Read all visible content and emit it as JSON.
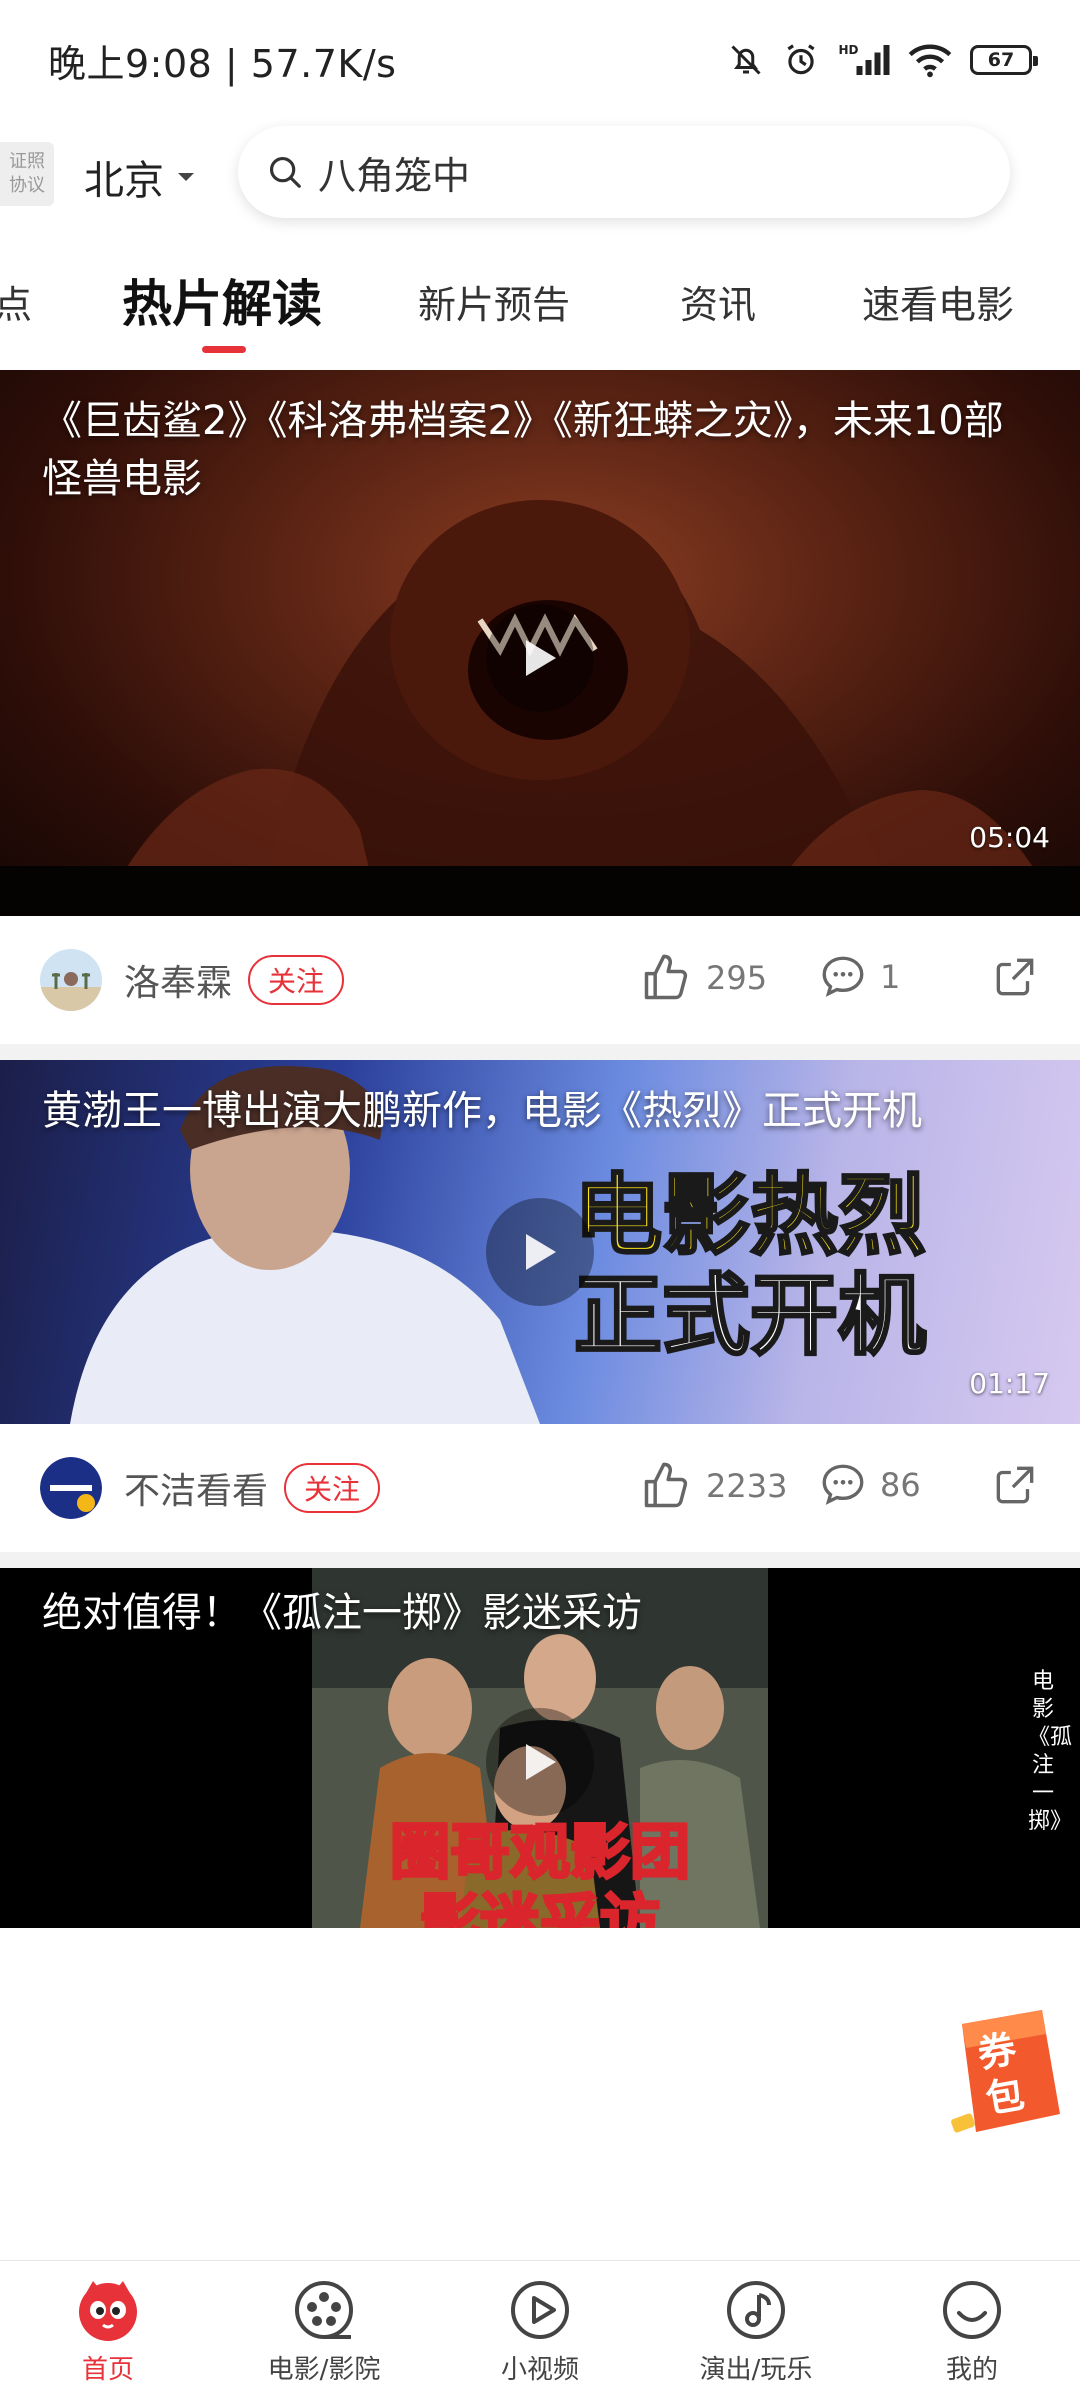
{
  "status": {
    "time": "晚上9:08 | 57.7K/s",
    "battery": "67",
    "icons": [
      "bell-off-icon",
      "alarm-icon",
      "hd-signal-icon",
      "wifi-icon",
      "battery-icon"
    ]
  },
  "header": {
    "license_line1": "证照",
    "license_line2": "协议",
    "city": "北京",
    "search_placeholder": "八角笼中"
  },
  "tabs": [
    {
      "label": "点",
      "active": false
    },
    {
      "label": "热片解读",
      "active": true
    },
    {
      "label": "新片预告",
      "active": false
    },
    {
      "label": "资讯",
      "active": false
    },
    {
      "label": "速看电影",
      "active": false
    }
  ],
  "feed": [
    {
      "title": "《巨齿鲨2》《科洛弗档案2》《新狂蟒之灾》，未来10部怪兽电影",
      "duration": "05:04",
      "author": "洛奉霖",
      "follow": "关注",
      "likes": "295",
      "comments": "1"
    },
    {
      "title": "黄渤王一博出演大鹏新作，电影《热烈》正式开机",
      "duration": "01:17",
      "poster_line1": "电影热烈",
      "poster_line2": "正式开机",
      "author": "不洁看看",
      "follow": "关注",
      "likes": "2233",
      "comments": "86"
    },
    {
      "title": "绝对值得！《孤注一掷》影迷采访",
      "poster_line1": "圈哥观影团",
      "poster_line2": "影迷采访",
      "side_text": "电影《孤注一掷》"
    }
  ],
  "coupon": {
    "label": "券包"
  },
  "bottom_nav": [
    {
      "label": "首页",
      "icon": "cat-home-icon",
      "active": true
    },
    {
      "label": "电影/影院",
      "icon": "film-reel-icon",
      "active": false
    },
    {
      "label": "小视频",
      "icon": "play-circle-icon",
      "active": false
    },
    {
      "label": "演出/玩乐",
      "icon": "music-note-icon",
      "active": false
    },
    {
      "label": "我的",
      "icon": "profile-icon",
      "active": false
    }
  ],
  "colors": {
    "accent": "#e8323a",
    "text": "#222222",
    "muted": "#777777"
  }
}
